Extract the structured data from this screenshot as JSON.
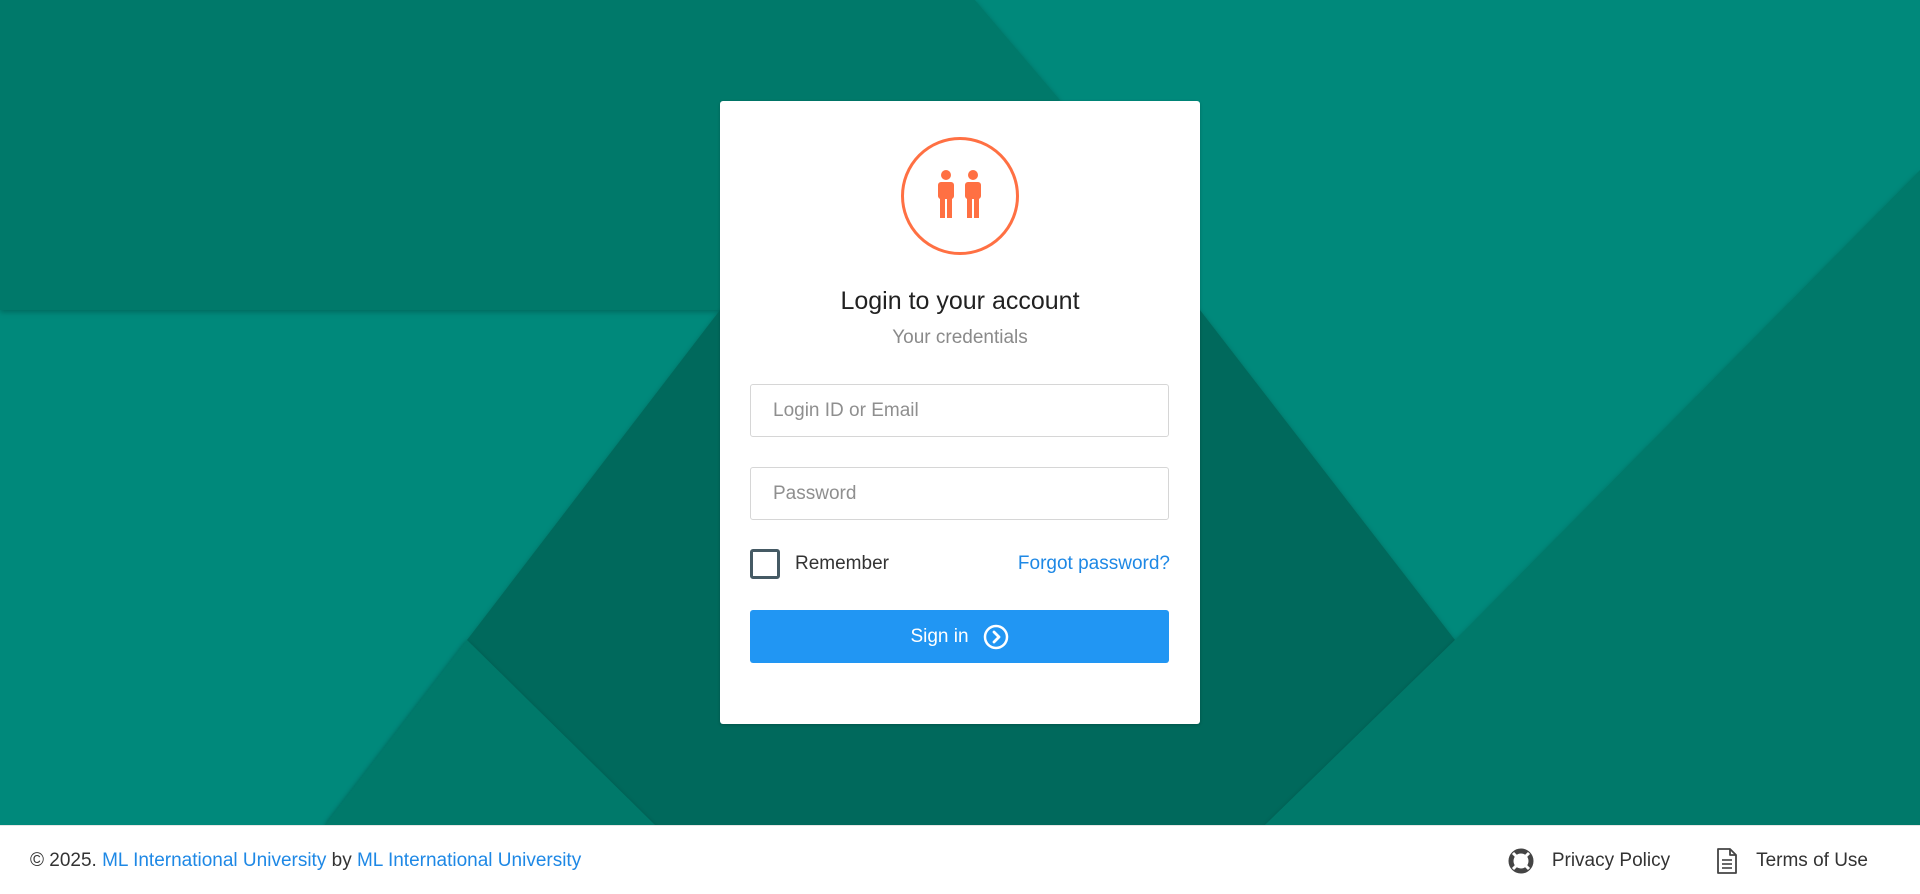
{
  "login": {
    "title": "Login to your account",
    "subtitle": "Your credentials",
    "login_placeholder": "Login ID or Email",
    "password_placeholder": "Password",
    "remember_label": "Remember",
    "forgot_label": "Forgot password?",
    "signin_label": "Sign in"
  },
  "footer": {
    "copyright_prefix": "© 2025.",
    "org_link": "ML International University",
    "by": "by",
    "author_link": "ML International University",
    "privacy_label": "Privacy Policy",
    "terms_label": "Terms of Use"
  },
  "icons": {
    "avatar": "users-icon",
    "signin": "circle-arrow-right-icon",
    "privacy": "lifebuoy-icon",
    "terms": "file-text-icon"
  },
  "colors": {
    "background": "#00897b",
    "accent": "#2196f3",
    "avatar": "#ff7043",
    "link": "#1e88e5"
  }
}
